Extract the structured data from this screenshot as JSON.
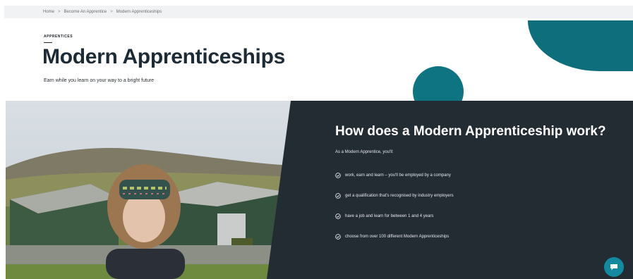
{
  "breadcrumb": [
    "Home",
    "Become An Apprentice",
    "Modern Apprenticeships"
  ],
  "breadcrumb_separator": ">",
  "hero": {
    "eyebrow": "APPRENTICES",
    "title": "Modern Apprenticeships",
    "subtitle": "Earn while you learn on your way to a bright future"
  },
  "info": {
    "title": "How does a Modern Apprenticeship work?",
    "intro": "As a Modern Apprentice, you'll:",
    "items": [
      "work, earn and learn – you'll be employed by a company",
      "get a qualification that's recognised by industry employers",
      "have a job and learn for between 1 and 4 years",
      "choose from over 100 different Modern Apprenticeships"
    ]
  },
  "icons": {
    "check": "check-circle-icon",
    "chat": "chat-bubble-icon"
  },
  "colors": {
    "teal": "#0f7482",
    "panel": "#232b33",
    "title": "#1d2b36"
  }
}
